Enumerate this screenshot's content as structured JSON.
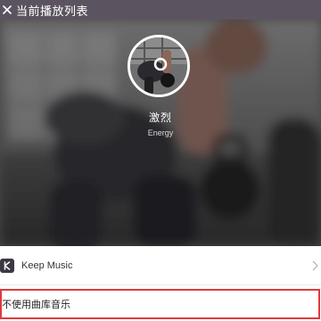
{
  "header": {
    "close_icon": "close-icon",
    "title": "当前播放列表",
    "background": "#5b5460"
  },
  "playlist": {
    "name": "激烈",
    "subtitle": "Energy",
    "cover_icon": "playlist-cover-image"
  },
  "sources": {
    "keep": {
      "label": "Keep Music",
      "icon": "keep-logo-icon",
      "chevron": "chevron-right-icon"
    },
    "none": {
      "label": "不使用曲库音乐",
      "highlight_color": "#e03a3a"
    }
  }
}
